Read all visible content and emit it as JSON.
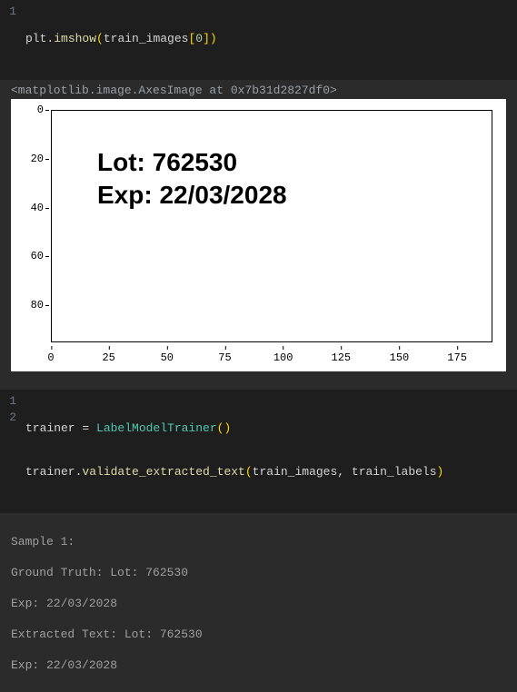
{
  "cell1": {
    "gutter": [
      "1"
    ],
    "code": {
      "obj": "plt",
      "method": "imshow",
      "arr": "train_images",
      "idx": "0"
    }
  },
  "repr": "<matplotlib.image.AxesImage at 0x7b31d2827df0>",
  "chart_data": {
    "type": "image",
    "title": "",
    "xlabel": "",
    "ylabel": "",
    "x_ticks": [
      "0",
      "25",
      "50",
      "75",
      "100",
      "125",
      "150",
      "175"
    ],
    "y_ticks": [
      "0",
      "20",
      "40",
      "60",
      "80"
    ],
    "xlim": [
      0,
      190
    ],
    "ylim": [
      0,
      95
    ],
    "image_text": {
      "line1": "Lot: 762530",
      "line2": "Exp: 22/03/2028"
    }
  },
  "cell2": {
    "gutter": [
      "1",
      "2"
    ],
    "line1": {
      "lhs": "trainer",
      "cls": "LabelModelTrainer"
    },
    "line2": {
      "obj": "trainer",
      "method": "validate_extracted_text",
      "arg1": "train_images",
      "arg2": "train_labels"
    }
  },
  "output2": {
    "l1": "Sample 1:",
    "l2": "Ground Truth: Lot: 762530",
    "l3": "Exp: 22/03/2028",
    "l4": "Extracted Text: Lot: 762530",
    "l5": "Exp: 22/03/2028"
  }
}
